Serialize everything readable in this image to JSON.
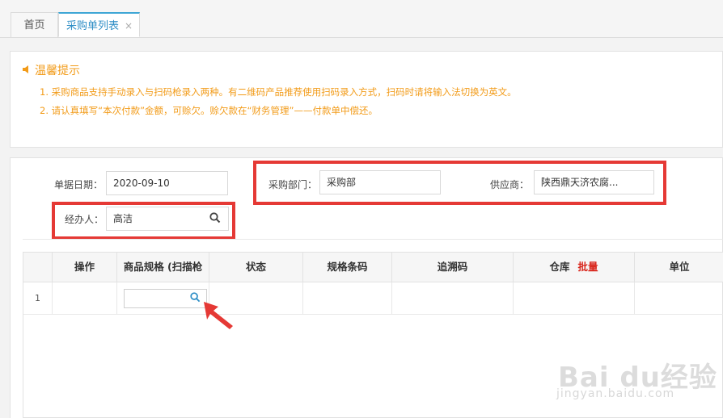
{
  "tabs": [
    {
      "label": "首页"
    },
    {
      "label": "采购单列表",
      "close": "×"
    }
  ],
  "tips": {
    "title": "温馨提示",
    "lines": [
      "1. 采购商品支持手动录入与扫码枪录入两种。有二维码产品推荐使用扫码录入方式，扫码时请将输入法切换为英文。",
      "2. 请认真填写“本次付款”金额，可赊欠。赊欠款在“财务管理”——付款单中偿还。"
    ]
  },
  "form": {
    "date_label": "单据日期：",
    "date_value": "2020-09-10",
    "dept_label": "采购部门：",
    "dept_value": "采购部",
    "supplier_label": "供应商：",
    "supplier_value": "陕西鼎天济农腐...",
    "handler_label": "经办人：",
    "handler_value": "高洁"
  },
  "table": {
    "headers": [
      "操作",
      "商品规格 (扫描枪",
      "状态",
      "规格条码",
      "追溯码",
      "仓库",
      "单位"
    ],
    "warehouse_batch_label": "批量",
    "rows": [
      {
        "num": "1"
      }
    ]
  },
  "watermark": {
    "brand": "Bai du经验",
    "url": "jingyan.baidu.com"
  },
  "colors": {
    "accent": "#2e8ec6",
    "tip": "#f29b18",
    "highlight": "#e53935"
  }
}
